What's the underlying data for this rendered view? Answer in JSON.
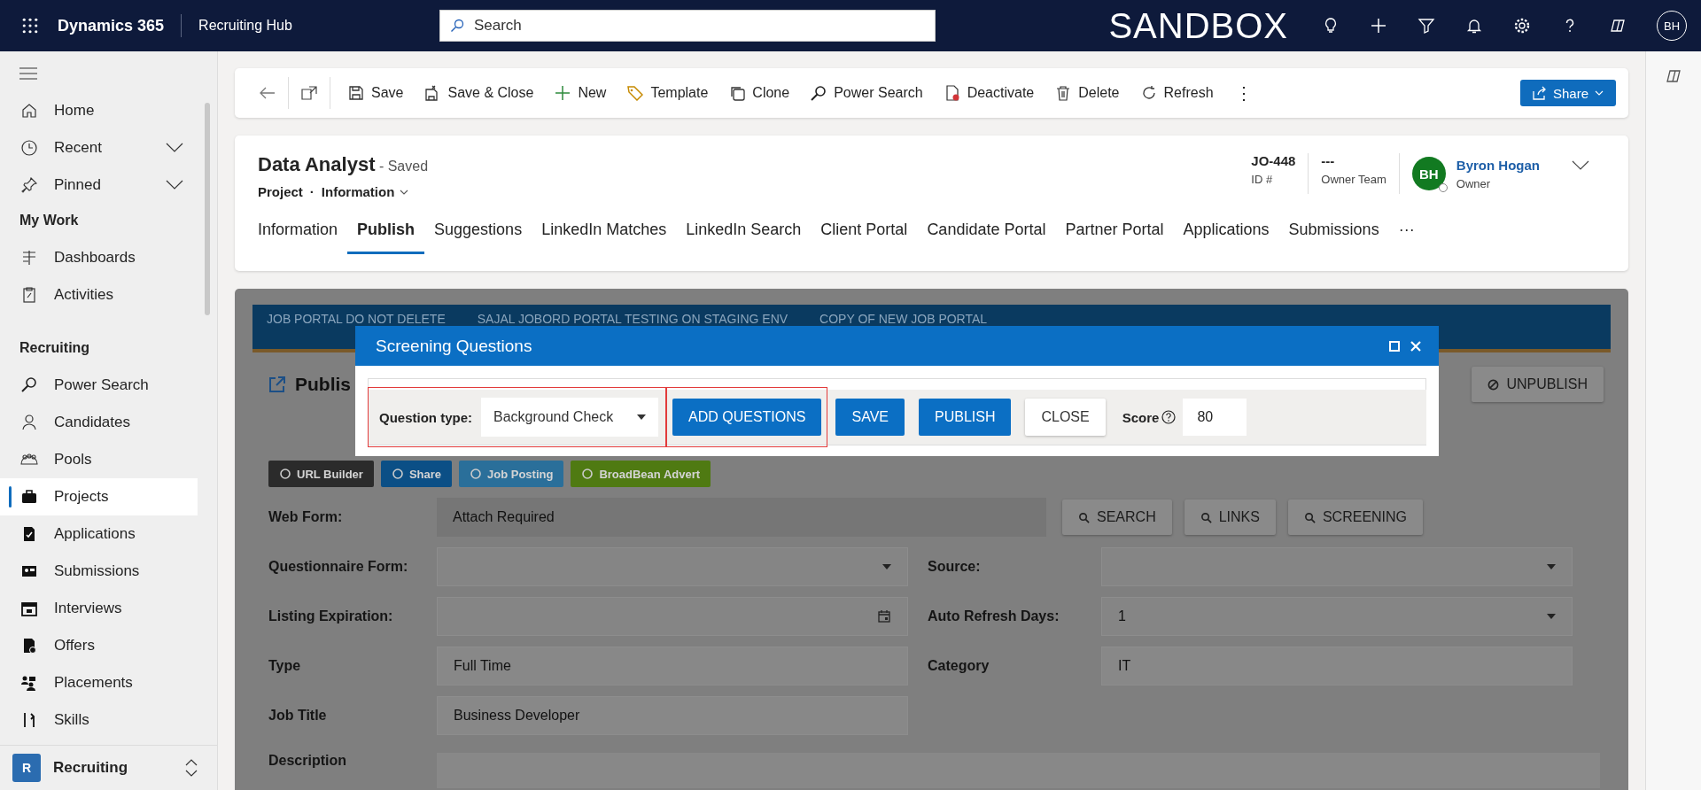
{
  "app_bar": {
    "app_name": "Dynamics 365",
    "area": "Recruiting Hub",
    "search_placeholder": "Search",
    "environment": "SANDBOX",
    "user_initials": "BH"
  },
  "sidebar": {
    "top_items": [
      {
        "label": "Home",
        "expandable": false
      },
      {
        "label": "Recent",
        "expandable": true
      },
      {
        "label": "Pinned",
        "expandable": true
      }
    ],
    "groups": [
      {
        "title": "My Work",
        "items": [
          {
            "label": "Dashboards",
            "selected": false
          },
          {
            "label": "Activities",
            "selected": false
          }
        ]
      },
      {
        "title": "Recruiting",
        "items": [
          {
            "label": "Power Search",
            "selected": false
          },
          {
            "label": "Candidates",
            "selected": false
          },
          {
            "label": "Pools",
            "selected": false
          },
          {
            "label": "Projects",
            "selected": true
          },
          {
            "label": "Applications",
            "selected": false
          },
          {
            "label": "Submissions",
            "selected": false
          },
          {
            "label": "Interviews",
            "selected": false
          },
          {
            "label": "Offers",
            "selected": false
          },
          {
            "label": "Placements",
            "selected": false
          },
          {
            "label": "Skills",
            "selected": false
          }
        ]
      }
    ],
    "area_switcher": {
      "initial": "R",
      "label": "Recruiting"
    }
  },
  "command_bar": {
    "commands": [
      "Save",
      "Save & Close",
      "New",
      "Template",
      "Clone",
      "Power Search",
      "Deactivate",
      "Delete",
      "Refresh"
    ],
    "more": "⋮",
    "share": "Share"
  },
  "record_header": {
    "title": "Data Analyst",
    "status": "- Saved",
    "entity": "Project",
    "separator": "·",
    "form": "Information",
    "fields": [
      {
        "value": "JO-448",
        "label": "ID #"
      },
      {
        "value": "---",
        "label": "Owner Team"
      }
    ],
    "owner": {
      "initials": "BH",
      "name": "Byron Hogan",
      "label": "Owner"
    },
    "tabs": [
      {
        "label": "Information",
        "selected": false
      },
      {
        "label": "Publish",
        "selected": true
      },
      {
        "label": "Suggestions",
        "selected": false
      },
      {
        "label": "LinkedIn Matches",
        "selected": false
      },
      {
        "label": "LinkedIn Search",
        "selected": false
      },
      {
        "label": "Client Portal",
        "selected": false
      },
      {
        "label": "Candidate Portal",
        "selected": false
      },
      {
        "label": "Partner Portal",
        "selected": false
      },
      {
        "label": "Applications",
        "selected": false
      },
      {
        "label": "Submissions",
        "selected": false
      }
    ],
    "more": "···"
  },
  "publish_panel": {
    "portal_tabs": [
      "JOB PORTAL DO NOT DELETE",
      "SAJAL JOBORD PORTAL TESTING ON STAGING ENV",
      "COPY OF NEW JOB PORTAL"
    ],
    "heading": "Publis",
    "unpublish": "UNPUBLISH",
    "share_buttons": [
      {
        "label": "URL Builder",
        "color": "#2b2b2b"
      },
      {
        "label": "Share",
        "color": "#0b4f86"
      },
      {
        "label": "Job Posting",
        "color": "#2a6f9a"
      },
      {
        "label": "BroadBean Advert",
        "color": "#4f7a12"
      }
    ],
    "web_form": {
      "label": "Web Form:",
      "value": "Attach Required",
      "actions": [
        "SEARCH",
        "LINKS",
        "SCREENING"
      ]
    },
    "fields": [
      {
        "label": "Questionnaire Form:",
        "kind": "select"
      },
      {
        "label": "Source:",
        "kind": "select"
      },
      {
        "label": "Listing Expiration:",
        "kind": "date"
      },
      {
        "label": "Auto Refresh Days:",
        "value": "1",
        "kind": "select"
      },
      {
        "label": "Type",
        "value": "Full Time",
        "kind": "text"
      },
      {
        "label": "Category",
        "value": "IT",
        "kind": "text"
      },
      {
        "label": "Job Title",
        "value": "Business Developer",
        "kind": "text"
      }
    ],
    "description_label": "Description"
  },
  "dialog": {
    "title": "Screening Questions",
    "question_type_label": "Question type:",
    "question_type": "Background Check",
    "highlighted": true,
    "buttons": [
      {
        "label": "ADD QUESTIONS",
        "kind": "primary",
        "highlighted": true
      },
      {
        "label": "SAVE",
        "kind": "primary",
        "highlighted": false
      },
      {
        "label": "PUBLISH",
        "kind": "primary",
        "highlighted": false
      },
      {
        "label": "CLOSE",
        "kind": "secondary",
        "highlighted": false
      }
    ],
    "score_label": "Score",
    "score": "80"
  }
}
